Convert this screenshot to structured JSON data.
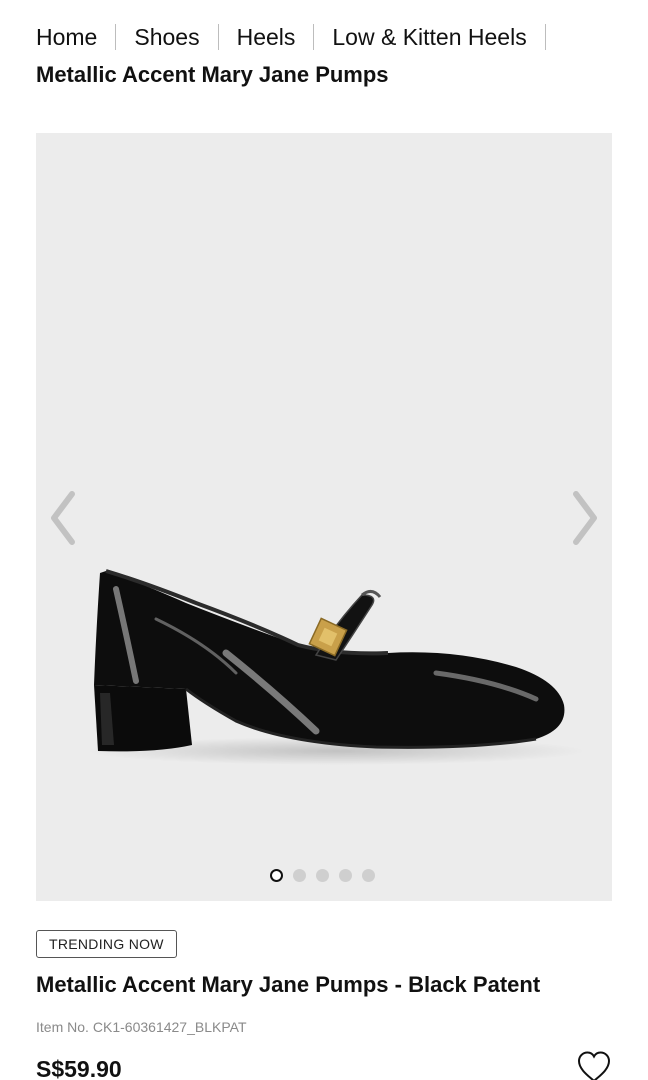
{
  "breadcrumb": {
    "items": [
      "Home",
      "Shoes",
      "Heels",
      "Low & Kitten Heels"
    ]
  },
  "page": {
    "title": "Metallic Accent Mary Jane Pumps"
  },
  "gallery": {
    "image_alt": "black patent mary jane pump with gold metallic accent buckle",
    "slide_count": 5,
    "active_slide": 1,
    "background": "#ececec",
    "icons": [
      "chevron-left-icon",
      "chevron-right-icon"
    ]
  },
  "product": {
    "badge": "TRENDING NOW",
    "name": "Metallic Accent Mary Jane Pumps - Black Patent",
    "item_no_label": "Item No.",
    "item_no": "CK1-60361427_BLKPAT",
    "price": "S$59.90",
    "wishlist_icon": "heart-icon"
  }
}
